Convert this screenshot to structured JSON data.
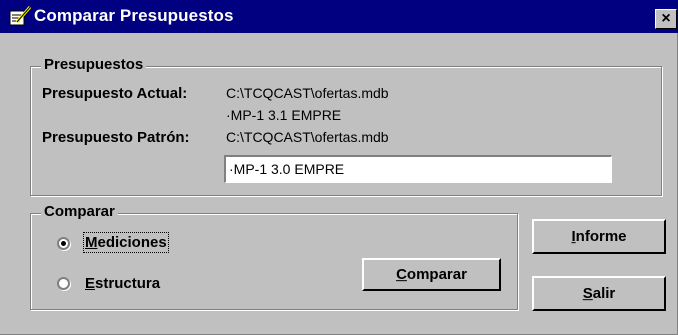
{
  "window": {
    "title": "Comparar Presupuestos",
    "close_label": "×"
  },
  "presupuestos": {
    "group_title": "Presupuestos",
    "actual_label": "Presupuesto Actual:",
    "actual_path": "C:\\TCQCAST\\ofertas.mdb",
    "actual_name": "·MP-1 3.1 EMPRE",
    "patron_label": "Presupuesto Patrón:",
    "patron_path": "C:\\TCQCAST\\ofertas.mdb",
    "patron_value": "·MP-1 3.0 EMPRE"
  },
  "comparar": {
    "group_title": "Comparar",
    "options": [
      {
        "label": "Mediciones",
        "selected": true
      },
      {
        "label": "Estructura",
        "selected": false
      }
    ],
    "button_label": "Comparar"
  },
  "actions": {
    "informe_label": "Informe",
    "salir_label": "Salir"
  },
  "colors": {
    "titlebar": "#000080",
    "face": "#c0c0c0"
  },
  "icons": {
    "title": "notepad-pencil-icon",
    "close": "close-icon"
  }
}
